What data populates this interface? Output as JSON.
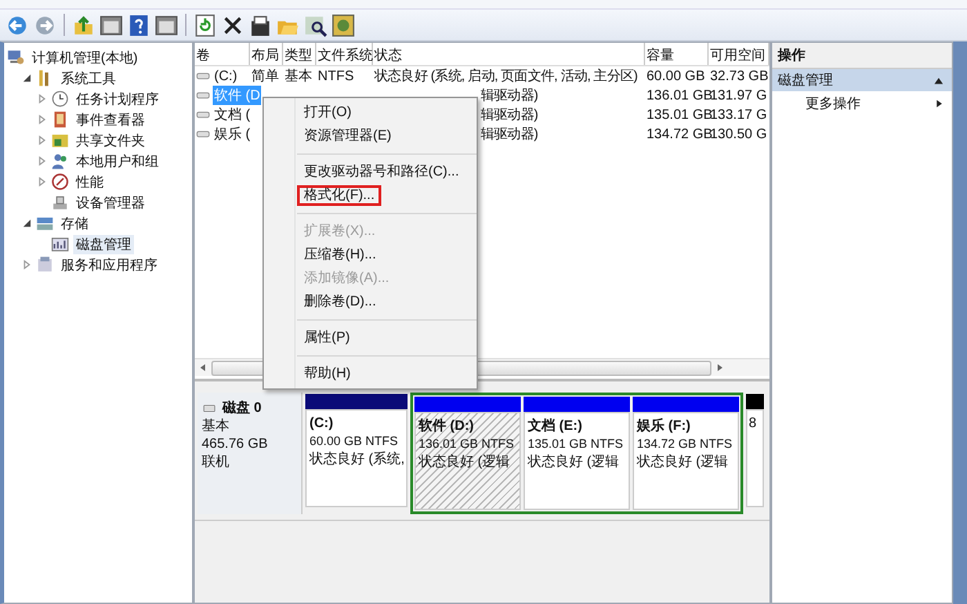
{
  "tree": [
    {
      "label": "计算机管理(本地)",
      "selected": false,
      "children": [
        {
          "label": "系统工具",
          "expanded": true,
          "selected": false,
          "children": [
            {
              "label": "任务计划程序",
              "expanded": false,
              "selected": false
            },
            {
              "label": "事件查看器",
              "expanded": false,
              "selected": false
            },
            {
              "label": "共享文件夹",
              "expanded": false,
              "selected": false
            },
            {
              "label": "本地用户和组",
              "expanded": false,
              "selected": false
            },
            {
              "label": "性能",
              "expanded": false,
              "selected": false
            },
            {
              "label": "设备管理器",
              "selected": false
            }
          ]
        },
        {
          "label": "存储",
          "expanded": true,
          "selected": false,
          "children": [
            {
              "label": "磁盘管理",
              "selected": true
            }
          ]
        },
        {
          "label": "服务和应用程序",
          "expanded": false,
          "selected": false
        }
      ]
    }
  ],
  "volumes": {
    "columns": [
      "卷",
      "布局",
      "类型",
      "文件系统",
      "状态",
      "容量",
      "可用空间"
    ],
    "rows": [
      {
        "selected": false,
        "cells": [
          "(C:)",
          "简单",
          "基本",
          "NTFS",
          "状态良好 (系统, 启动, 页面文件, 活动, 主分区)",
          "60.00 GB",
          "32.73 GB"
        ]
      },
      {
        "selected": true,
        "cells": [
          "软件 (D",
          null,
          null,
          null,
          "辑驱动器)",
          "136.01 GB",
          "131.97 G"
        ]
      },
      {
        "selected": false,
        "cells": [
          "文档 (",
          null,
          null,
          null,
          "辑驱动器)",
          "135.01 GB",
          "133.17 G"
        ]
      },
      {
        "selected": false,
        "cells": [
          "娱乐 (",
          null,
          null,
          null,
          "辑驱动器)",
          "134.72 GB",
          "130.50 G"
        ]
      }
    ]
  },
  "context_menu": [
    {
      "kind": "item",
      "label": "打开(O)",
      "disabled": false,
      "highlighted": false
    },
    {
      "kind": "item",
      "label": "资源管理器(E)",
      "disabled": false,
      "highlighted": false
    },
    {
      "kind": "separator"
    },
    {
      "kind": "item",
      "label": "更改驱动器号和路径(C)...",
      "disabled": false,
      "highlighted": false
    },
    {
      "kind": "item",
      "label": "格式化(F)...",
      "disabled": false,
      "highlighted": true
    },
    {
      "kind": "separator"
    },
    {
      "kind": "item",
      "label": "扩展卷(X)...",
      "disabled": true,
      "highlighted": false
    },
    {
      "kind": "item",
      "label": "压缩卷(H)...",
      "disabled": false,
      "highlighted": false
    },
    {
      "kind": "item",
      "label": "添加镜像(A)...",
      "disabled": true,
      "highlighted": false
    },
    {
      "kind": "item",
      "label": "删除卷(D)...",
      "disabled": false,
      "highlighted": false
    },
    {
      "kind": "separator"
    },
    {
      "kind": "item",
      "label": "属性(P)",
      "disabled": false,
      "highlighted": false
    },
    {
      "kind": "separator"
    },
    {
      "kind": "item",
      "label": "帮助(H)",
      "disabled": false,
      "highlighted": false
    }
  ],
  "disk": {
    "name": "磁盘 0",
    "type": "基本",
    "size": "465.76 GB",
    "status": "联机",
    "partitions": [
      {
        "kind": "primary",
        "selected": false,
        "lines": [
          "(C:)",
          "60.00 GB NTFS",
          "状态良好 (系统,"
        ]
      },
      {
        "kind": "logical",
        "selected": true,
        "lines": [
          "软件  (D:)",
          "136.01 GB NTFS",
          "状态良好 (逻辑"
        ]
      },
      {
        "kind": "logical",
        "selected": false,
        "lines": [
          "文档  (E:)",
          "135.01 GB NTFS",
          "状态良好 (逻辑"
        ]
      },
      {
        "kind": "logical",
        "selected": false,
        "lines": [
          "娱乐  (F:)",
          "134.72 GB NTFS",
          "状态良好 (逻辑"
        ]
      },
      {
        "kind": "unallocated",
        "selected": false,
        "lines": [
          "8"
        ]
      }
    ]
  },
  "actions": {
    "title": "操作",
    "section": {
      "label": "磁盘管理",
      "expanded": true
    },
    "items": [
      {
        "label": "更多操作"
      }
    ]
  }
}
